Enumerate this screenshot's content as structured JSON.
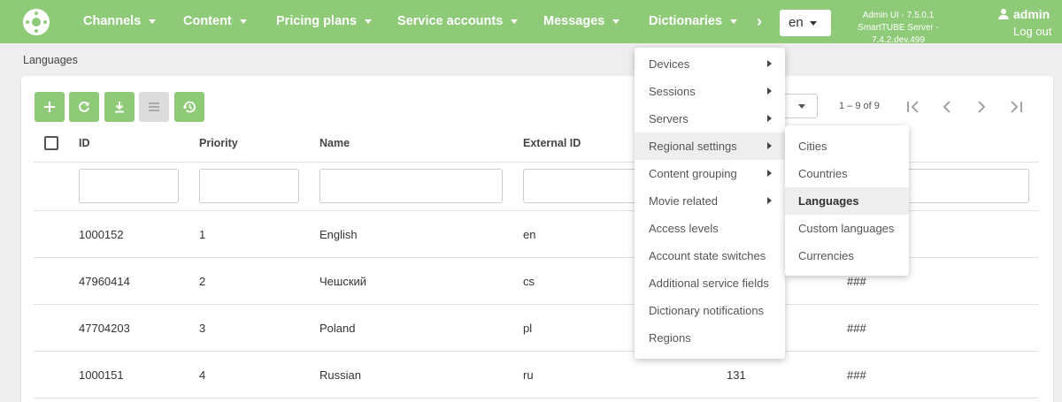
{
  "nav": {
    "items": [
      {
        "label": "Channels"
      },
      {
        "label": "Content"
      },
      {
        "label": "Pricing plans"
      },
      {
        "label": "Service accounts"
      },
      {
        "label": "Messages"
      },
      {
        "label": "Dictionaries"
      }
    ],
    "more": "›",
    "language": "en",
    "version_ui": "Admin UI - 7.5.0.1",
    "version_server": "SmartTUBE Server - 7.4.2.dev.499",
    "user": "admin",
    "logout": "Log out"
  },
  "breadcrumb": "Languages",
  "toolbar": {
    "icons": [
      "add-icon",
      "refresh-icon",
      "download-icon",
      "columns-icon",
      "history-icon"
    ]
  },
  "pager": {
    "range": "1 – 9 of 9"
  },
  "table": {
    "columns": [
      "ID",
      "Priority",
      "Name",
      "External ID"
    ],
    "rows": [
      {
        "id": "1000152",
        "priority": "1",
        "name": "English",
        "ext": "en",
        "code": "",
        "hash": ""
      },
      {
        "id": "47960414",
        "priority": "2",
        "name": "Чешский",
        "ext": "cs",
        "code": "",
        "hash": "###"
      },
      {
        "id": "47704203",
        "priority": "3",
        "name": "Poland",
        "ext": "pl",
        "code": "",
        "hash": "###"
      },
      {
        "id": "1000151",
        "priority": "4",
        "name": "Russian",
        "ext": "ru",
        "code": "131",
        "hash": "###"
      }
    ]
  },
  "menu": {
    "items": [
      {
        "label": "Devices"
      },
      {
        "label": "Sessions"
      },
      {
        "label": "Servers"
      },
      {
        "label": "Regional settings"
      },
      {
        "label": "Content grouping"
      },
      {
        "label": "Movie related"
      },
      {
        "label": "Access levels"
      },
      {
        "label": "Account state switches"
      },
      {
        "label": "Additional service fields"
      },
      {
        "label": "Dictionary notifications"
      },
      {
        "label": "Regions"
      }
    ]
  },
  "submenu": {
    "items": [
      {
        "label": "Cities"
      },
      {
        "label": "Countries"
      },
      {
        "label": "Languages"
      },
      {
        "label": "Custom languages"
      },
      {
        "label": "Currencies"
      }
    ]
  }
}
